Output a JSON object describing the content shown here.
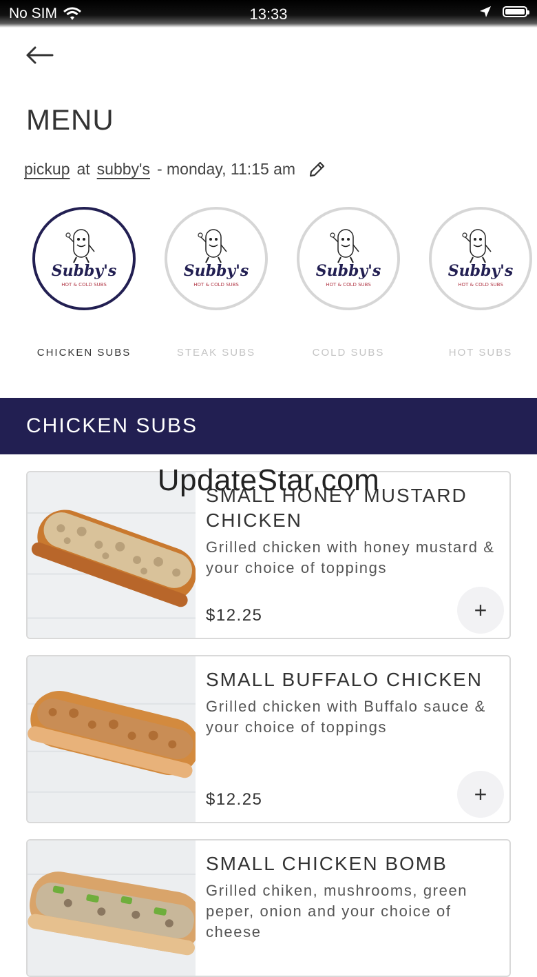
{
  "status_bar": {
    "carrier": "No SIM",
    "time": "13:33"
  },
  "header": {
    "title": "MENU"
  },
  "order": {
    "mode": "pickup",
    "at": "at",
    "location": "subby's",
    "time": "- monday, 11:15 am"
  },
  "categories": [
    {
      "label": "CHICKEN SUBS",
      "active": true,
      "logo_text": "Subby's",
      "logo_sub": "HOT & COLD SUBS"
    },
    {
      "label": "STEAK SUBS",
      "active": false,
      "logo_text": "Subby's",
      "logo_sub": "HOT & COLD SUBS"
    },
    {
      "label": "COLD SUBS",
      "active": false,
      "logo_text": "Subby's",
      "logo_sub": "HOT & COLD SUBS"
    },
    {
      "label": "HOT SUBS",
      "active": false,
      "logo_text": "Subby's",
      "logo_sub": "HOT & COLD SUBS"
    }
  ],
  "section": {
    "title": "CHICKEN SUBS"
  },
  "items": [
    {
      "name": "SMALL HONEY MUSTARD CHICKEN",
      "description": "Grilled chicken with honey mustard & your choice of toppings",
      "price": "$12.25",
      "add_label": "+"
    },
    {
      "name": "SMALL BUFFALO CHICKEN",
      "description": "Grilled chicken with Buffalo sauce & your choice of toppings",
      "price": "$12.25",
      "add_label": "+"
    },
    {
      "name": "SMALL CHICKEN BOMB",
      "description": "Grilled chiken, mushrooms, green peper, onion and your choice of cheese",
      "price": "",
      "add_label": "+"
    }
  ],
  "watermark": "UpdateStar.com",
  "colors": {
    "brand_navy": "#221f52",
    "logo_red": "#b23a48",
    "card_border": "#d9d9d9"
  }
}
